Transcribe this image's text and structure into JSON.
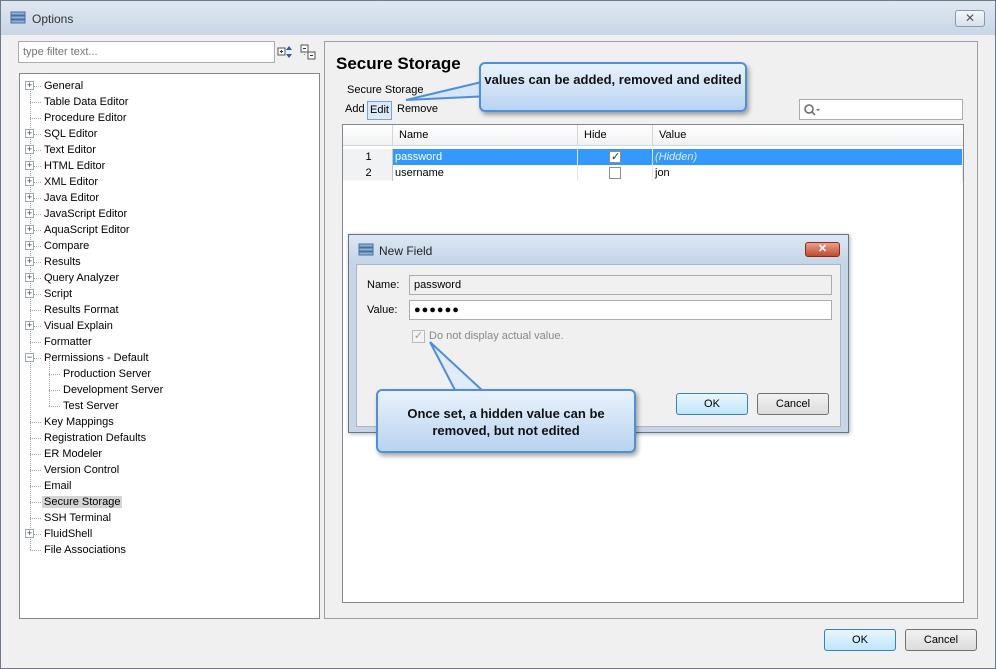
{
  "window": {
    "title": "Options",
    "close": "✕"
  },
  "filter": {
    "placeholder": "type filter text..."
  },
  "tree": [
    {
      "label": "General",
      "expandable": true,
      "depth": 0
    },
    {
      "label": "Table Data Editor",
      "expandable": false,
      "depth": 0
    },
    {
      "label": "Procedure Editor",
      "expandable": false,
      "depth": 0
    },
    {
      "label": "SQL Editor",
      "expandable": true,
      "depth": 0
    },
    {
      "label": "Text Editor",
      "expandable": true,
      "depth": 0
    },
    {
      "label": "HTML Editor",
      "expandable": true,
      "depth": 0
    },
    {
      "label": "XML Editor",
      "expandable": true,
      "depth": 0
    },
    {
      "label": "Java Editor",
      "expandable": true,
      "depth": 0
    },
    {
      "label": "JavaScript Editor",
      "expandable": true,
      "depth": 0
    },
    {
      "label": "AquaScript Editor",
      "expandable": true,
      "depth": 0
    },
    {
      "label": "Compare",
      "expandable": true,
      "depth": 0
    },
    {
      "label": "Results",
      "expandable": true,
      "depth": 0
    },
    {
      "label": "Query Analyzer",
      "expandable": true,
      "depth": 0
    },
    {
      "label": "Script",
      "expandable": true,
      "depth": 0
    },
    {
      "label": "Results Format",
      "expandable": false,
      "depth": 0
    },
    {
      "label": "Visual Explain",
      "expandable": true,
      "depth": 0
    },
    {
      "label": "Formatter",
      "expandable": false,
      "depth": 0
    },
    {
      "label": "Permissions - Default",
      "expandable": true,
      "expanded": true,
      "depth": 0
    },
    {
      "label": "Production Server",
      "expandable": false,
      "depth": 1
    },
    {
      "label": "Development Server",
      "expandable": false,
      "depth": 1
    },
    {
      "label": "Test Server",
      "expandable": false,
      "depth": 1
    },
    {
      "label": "Key Mappings",
      "expandable": false,
      "depth": 0
    },
    {
      "label": "Registration Defaults",
      "expandable": false,
      "depth": 0
    },
    {
      "label": "ER Modeler",
      "expandable": false,
      "depth": 0
    },
    {
      "label": "Version Control",
      "expandable": false,
      "depth": 0
    },
    {
      "label": "Email",
      "expandable": false,
      "depth": 0
    },
    {
      "label": "Secure Storage",
      "expandable": false,
      "depth": 0,
      "selected": true
    },
    {
      "label": "SSH Terminal",
      "expandable": false,
      "depth": 0
    },
    {
      "label": "FluidShell",
      "expandable": true,
      "depth": 0
    },
    {
      "label": "File Associations",
      "expandable": false,
      "depth": 0
    }
  ],
  "page": {
    "title": "Secure Storage",
    "group_label": "Secure Storage",
    "toolbar": {
      "add": "Add",
      "edit": "Edit",
      "remove": "Remove"
    },
    "table": {
      "headers": [
        "Name",
        "Hide",
        "Value"
      ],
      "rows": [
        {
          "num": "1",
          "name": "password",
          "hide": true,
          "value": "(Hidden)",
          "selected": true
        },
        {
          "num": "2",
          "name": "username",
          "hide": false,
          "value": "jon",
          "selected": false
        }
      ]
    }
  },
  "dialog": {
    "title": "New Field",
    "close": "✕",
    "name_label": "Name:",
    "name_value": "password",
    "value_label": "Value:",
    "value_value": "●●●●●●",
    "checkbox_label": "Do not display actual value.",
    "ok": "OK",
    "cancel": "Cancel"
  },
  "callouts": {
    "top": "values can be added, removed and edited",
    "bottom": "Once set, a hidden value can be removed, but not edited"
  },
  "footer": {
    "ok": "OK",
    "cancel": "Cancel"
  },
  "colors": {
    "selection": "#3399ff",
    "callout_border": "#4f8fd8"
  }
}
